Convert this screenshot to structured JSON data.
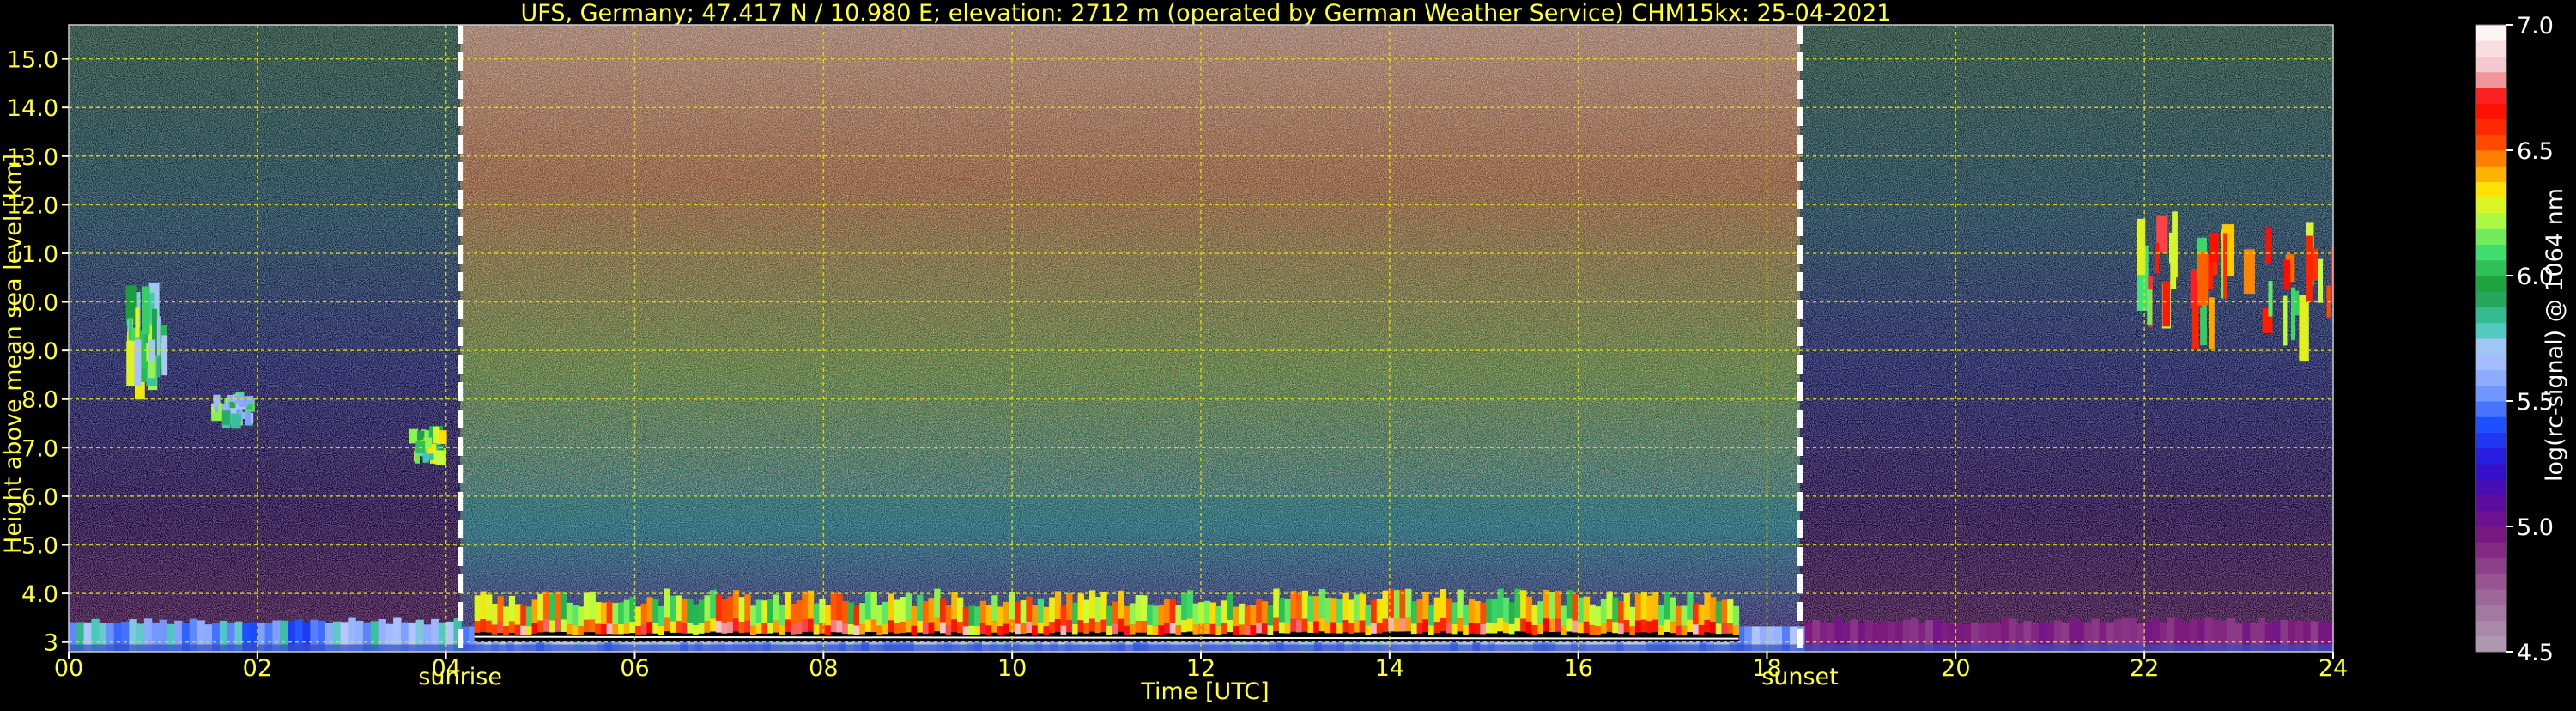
{
  "chart_data": {
    "type": "heatmap",
    "title": "UFS, Germany; 47.417 N / 10.980 E; elevation: 2712 m  (operated by German Weather Service)    CHM15kx: 25-04-2021",
    "xlabel": "Time [UTC]",
    "ylabel": "Height above mean sea level [km]",
    "xlim": [
      0,
      24
    ],
    "ylim": [
      2.8,
      15.7
    ],
    "x_ticks": [
      {
        "value": 0,
        "label": "00"
      },
      {
        "value": 2,
        "label": "02"
      },
      {
        "value": 4,
        "label": "04"
      },
      {
        "value": 6,
        "label": "06"
      },
      {
        "value": 8,
        "label": "08"
      },
      {
        "value": 10,
        "label": "10"
      },
      {
        "value": 12,
        "label": "12"
      },
      {
        "value": 14,
        "label": "14"
      },
      {
        "value": 16,
        "label": "16"
      },
      {
        "value": 18,
        "label": "18"
      },
      {
        "value": 20,
        "label": "20"
      },
      {
        "value": 22,
        "label": "22"
      },
      {
        "value": 24,
        "label": "24"
      }
    ],
    "y_ticks": [
      {
        "value": 3,
        "label": "3"
      },
      {
        "value": 4,
        "label": "4.0"
      },
      {
        "value": 5,
        "label": "5.0"
      },
      {
        "value": 6,
        "label": "6.0"
      },
      {
        "value": 7,
        "label": "7.0"
      },
      {
        "value": 8,
        "label": "8.0"
      },
      {
        "value": 9,
        "label": "9.0"
      },
      {
        "value": 10,
        "label": "10.0"
      },
      {
        "value": 11,
        "label": "11.0"
      },
      {
        "value": 12,
        "label": "12.0"
      },
      {
        "value": 13,
        "label": "13.0"
      },
      {
        "value": 14,
        "label": "14.0"
      },
      {
        "value": 15,
        "label": "15.0"
      }
    ],
    "y_tick_labels_display": [
      "3",
      "4.0",
      "5.0",
      "6.0",
      "7.0",
      "8.0",
      "9.0",
      "10.0",
      "11.0",
      "12.0",
      "13.0",
      "14.0",
      "15.0"
    ],
    "grid": true,
    "colors": {
      "axis_text": "#ffff33",
      "grid": "#e6e600",
      "background": "#000000",
      "marker": "#ffffff",
      "colorbar_label": "#ffffff"
    },
    "events": [
      {
        "name": "sunrise",
        "x": 4.15
      },
      {
        "name": "sunset",
        "x": 18.35
      }
    ],
    "colorbar": {
      "label": "log(rc-signal) @ 1064 nm",
      "range": [
        4.5,
        7.0
      ],
      "ticks": [
        {
          "value": 4.5,
          "label": "4.5"
        },
        {
          "value": 5.0,
          "label": "5.0"
        },
        {
          "value": 5.5,
          "label": "5.5"
        },
        {
          "value": 6.0,
          "label": "6.0"
        },
        {
          "value": 6.5,
          "label": "6.5"
        },
        {
          "value": 7.0,
          "label": "7.0"
        }
      ],
      "stops": [
        {
          "value": 4.5,
          "color": "#b4a0b4"
        },
        {
          "value": 4.65,
          "color": "#a47aa4"
        },
        {
          "value": 4.8,
          "color": "#94508f"
        },
        {
          "value": 4.95,
          "color": "#7d1a7d"
        },
        {
          "value": 5.1,
          "color": "#5a0ca0"
        },
        {
          "value": 5.25,
          "color": "#2a10d8"
        },
        {
          "value": 5.4,
          "color": "#1a4dff"
        },
        {
          "value": 5.55,
          "color": "#7fa0ff"
        },
        {
          "value": 5.7,
          "color": "#b4c8ff"
        },
        {
          "value": 5.8,
          "color": "#40c8b4"
        },
        {
          "value": 5.95,
          "color": "#1a9a3a"
        },
        {
          "value": 6.1,
          "color": "#40e070"
        },
        {
          "value": 6.25,
          "color": "#c8ff3a"
        },
        {
          "value": 6.35,
          "color": "#ffe000"
        },
        {
          "value": 6.45,
          "color": "#ff9000"
        },
        {
          "value": 6.55,
          "color": "#ff3a00"
        },
        {
          "value": 6.7,
          "color": "#ff0000"
        },
        {
          "value": 6.8,
          "color": "#f0b8c0"
        },
        {
          "value": 7.0,
          "color": "#ffffff"
        }
      ]
    },
    "features": [
      {
        "name": "boundary-layer-aerosol",
        "x": [
          0,
          24
        ],
        "y": [
          2.8,
          3.5
        ],
        "level": 5.6
      },
      {
        "name": "daytime-convective-layer",
        "x": [
          4.3,
          17.7
        ],
        "y": [
          3.0,
          4.1
        ],
        "level": 6.3
      },
      {
        "name": "night-cloud-a",
        "x": [
          0.6,
          1.0
        ],
        "y": [
          8.5,
          10.0
        ],
        "level": 6.0
      },
      {
        "name": "night-cloud-b",
        "x": [
          1.5,
          1.9
        ],
        "y": [
          7.5,
          8.0
        ],
        "level": 5.9
      },
      {
        "name": "night-cloud-c",
        "x": [
          3.6,
          3.9
        ],
        "y": [
          6.8,
          7.3
        ],
        "level": 6.1
      },
      {
        "name": "cirrus-layer",
        "x": [
          21.9,
          24
        ],
        "y": [
          9.4,
          11.4
        ],
        "level": 6.4
      }
    ]
  }
}
